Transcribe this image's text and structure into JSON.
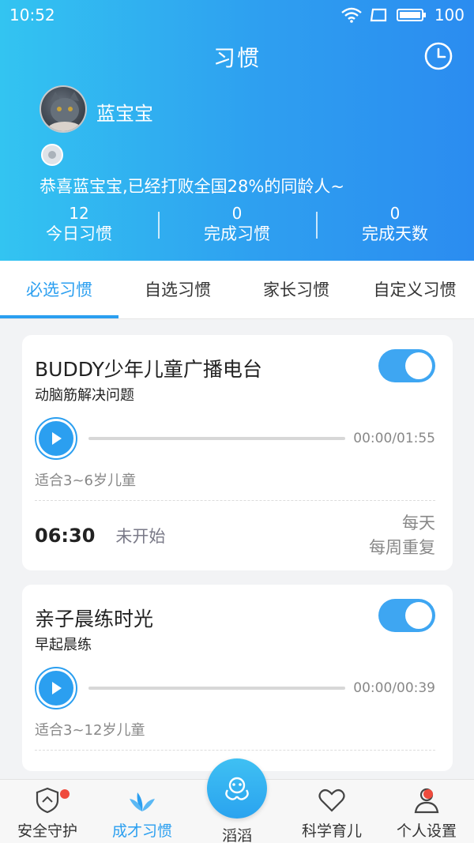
{
  "status_bar": {
    "time": "10:52",
    "battery": "100"
  },
  "header": {
    "title": "习惯",
    "username": "蓝宝宝",
    "congrats": "恭喜蓝宝宝,已经打败全国28%的同龄人~",
    "stats": [
      {
        "value": "12",
        "label": "今日习惯"
      },
      {
        "value": "0",
        "label": "完成习惯"
      },
      {
        "value": "0",
        "label": "完成天数"
      }
    ]
  },
  "tabs": [
    {
      "label": "必选习惯",
      "active": true
    },
    {
      "label": "自选习惯",
      "active": false
    },
    {
      "label": "家长习惯",
      "active": false
    },
    {
      "label": "自定义习惯",
      "active": false
    }
  ],
  "cards": [
    {
      "title": "BUDDY少年儿童广播电台",
      "subtitle": "动脑筋解决问题",
      "time": "00:00/01:55",
      "age": "适合3~6岁儿童",
      "schedule_time": "06:30",
      "status": "未开始",
      "repeat1": "每天",
      "repeat2": "每周重复",
      "enabled": true
    },
    {
      "title": "亲子晨练时光",
      "subtitle": "早起晨练",
      "time": "00:00/00:39",
      "age": "适合3~12岁儿童",
      "enabled": true
    }
  ],
  "bottom_nav": [
    {
      "label": "安全守护",
      "icon": "shield-icon"
    },
    {
      "label": "成才习惯",
      "icon": "leaf-icon",
      "active": true
    },
    {
      "label": "滔滔",
      "icon": "robot-icon"
    },
    {
      "label": "科学育儿",
      "icon": "heart-icon"
    },
    {
      "label": "个人设置",
      "icon": "person-icon"
    }
  ],
  "colors": {
    "accent": "#2b9ff0",
    "gradient_start": "#33c4f1",
    "gradient_end": "#2b8cf0",
    "notification_dot": "#ef4b3d"
  }
}
